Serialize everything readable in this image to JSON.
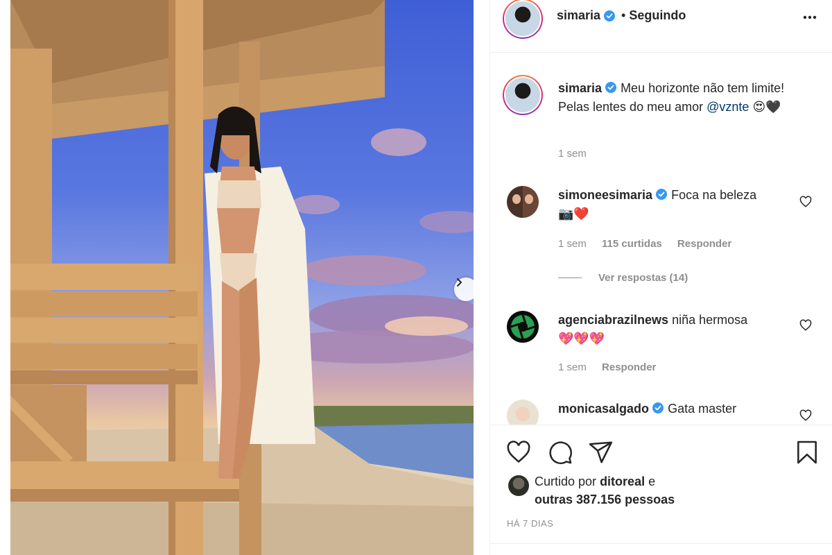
{
  "post": {
    "image_alt": "Woman in floral bikini and white kimono standing on a wooden lifeguard tower at sunset on a beach",
    "next_label": "Next"
  },
  "header": {
    "username": "simaria",
    "separator": "•",
    "follow_status": "Seguindo",
    "more_icon": "more-icon"
  },
  "caption": {
    "username": "simaria",
    "text": "Meu horizonte não tem limite! Pelas lentes do meu amor",
    "mention": "@vznte",
    "emoji": "😍🖤",
    "time": "1 sem"
  },
  "comments": [
    {
      "username": "simoneesimaria",
      "verified": true,
      "text": "Foca na beleza",
      "emoji": "📷❤️",
      "time": "1 sem",
      "likes": "115 curtidas",
      "reply": "Responder",
      "view_replies": "Ver respostas (14)"
    },
    {
      "username": "agenciabrazilnews",
      "verified": false,
      "text": "niña hermosa",
      "emoji": "💖💖💖",
      "time": "1 sem",
      "reply": "Responder"
    },
    {
      "username": "monicasalgado",
      "verified": true,
      "text": "Gata master"
    }
  ],
  "actions": {
    "like_icon": "heart-icon",
    "comment_icon": "comment-icon",
    "share_icon": "share-icon",
    "save_icon": "bookmark-icon"
  },
  "likes": {
    "prefix": "Curtido por",
    "liker": "ditoreal",
    "connector": "e",
    "others": "outras 387.156 pessoas"
  },
  "timestamp": "HÁ 7 DIAS",
  "colors": {
    "verified_blue": "#3897f0",
    "text": "#262626",
    "muted": "#8e8e8e",
    "link": "#00376b",
    "border": "#efefef"
  }
}
